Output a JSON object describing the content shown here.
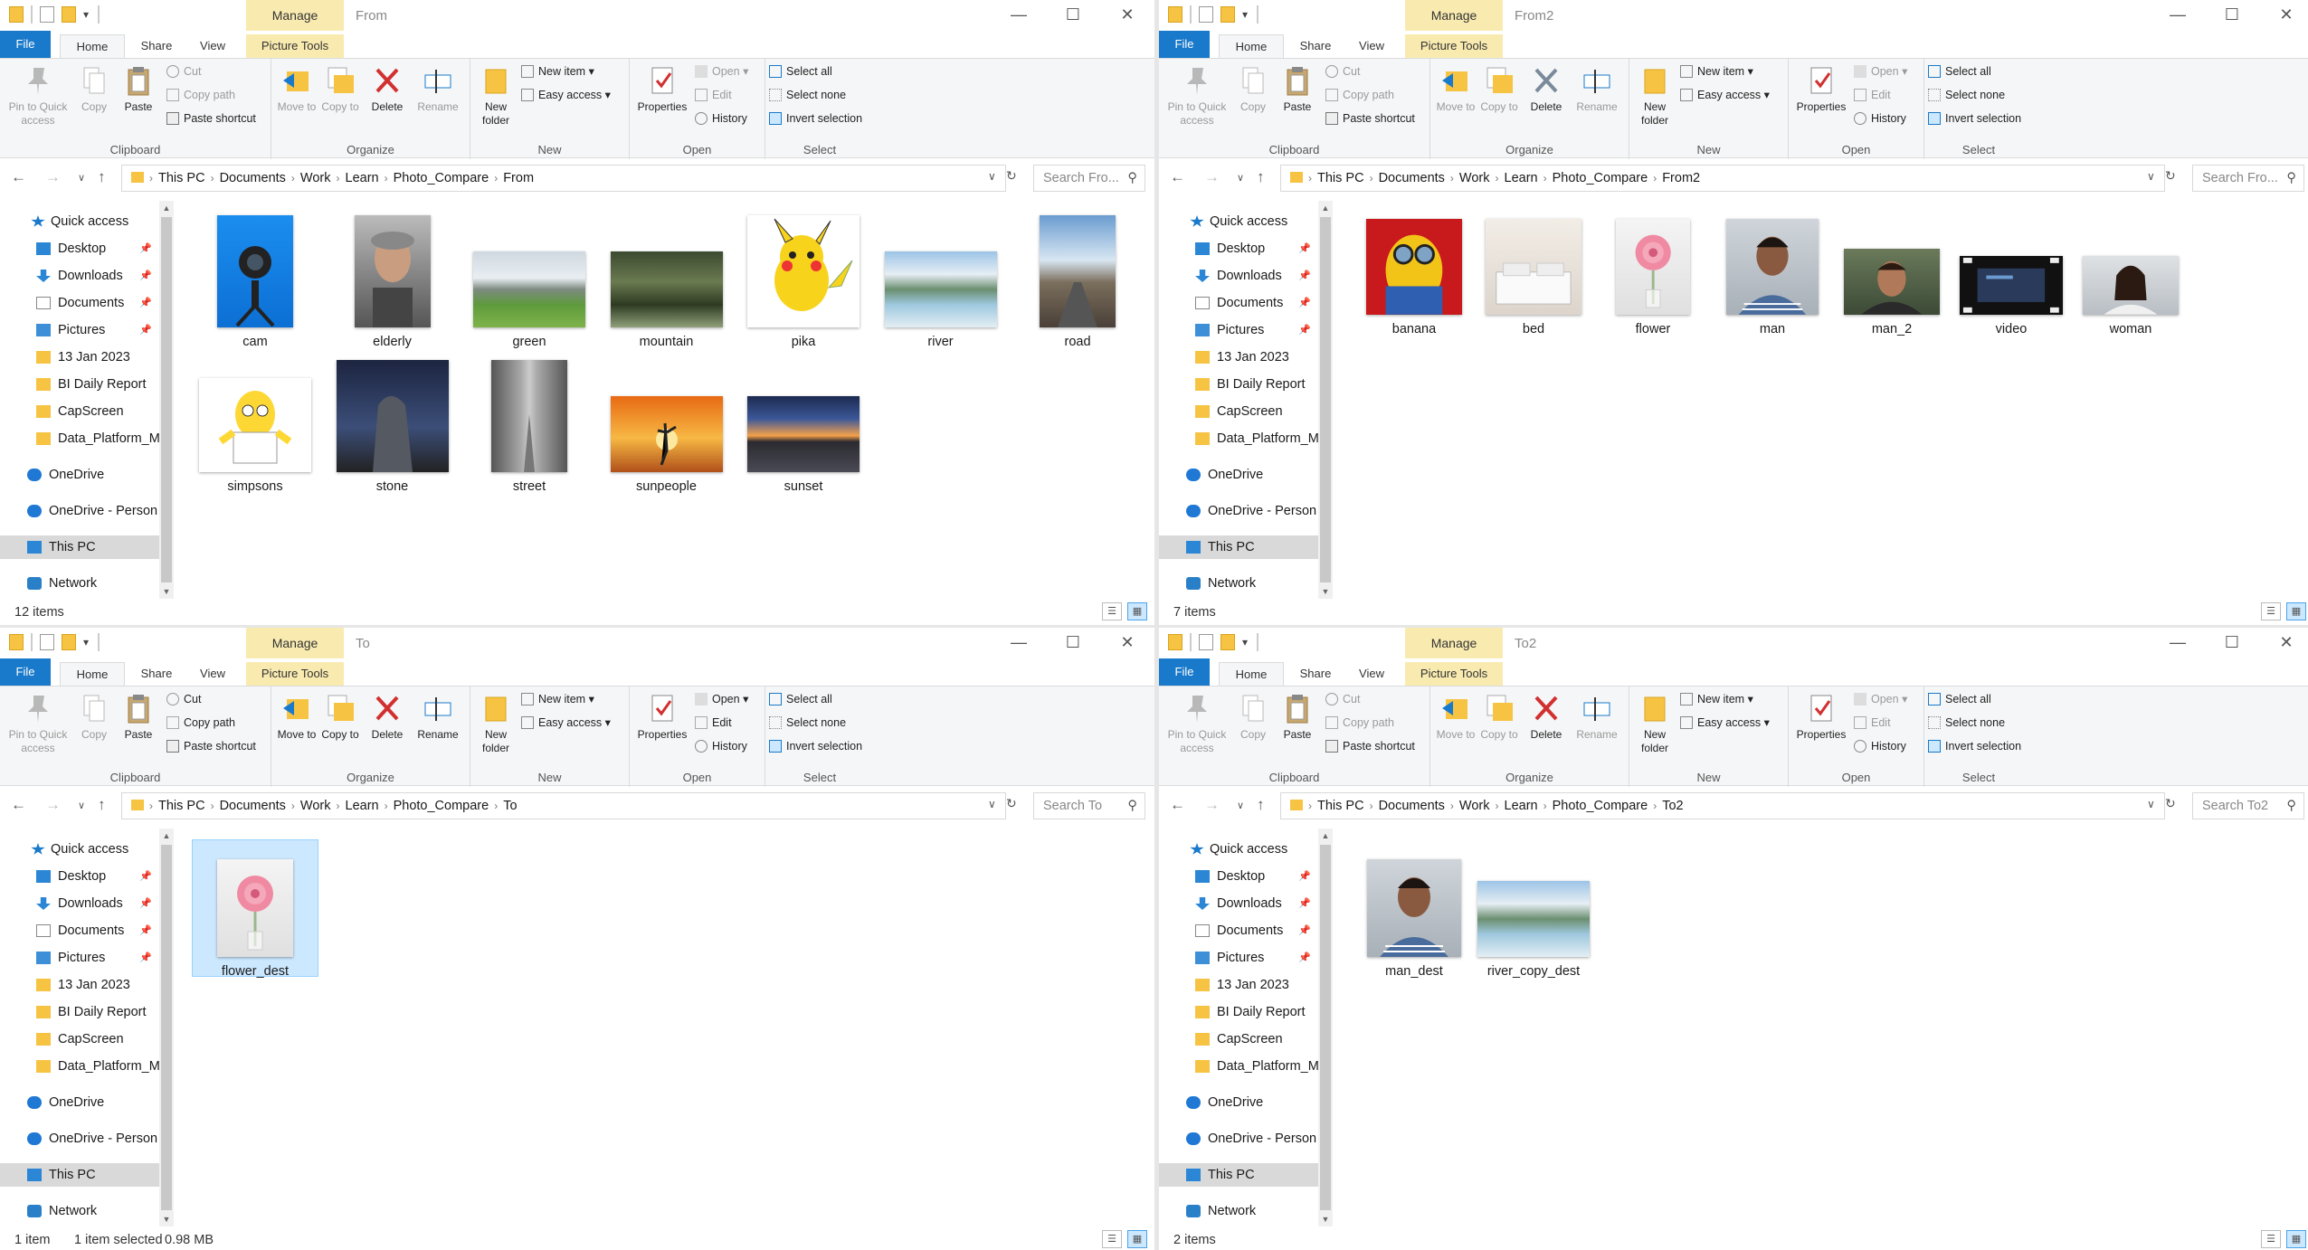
{
  "ribbon": {
    "tabs": {
      "file": "File",
      "home": "Home",
      "share": "Share",
      "view": "View",
      "picture_tools": "Picture Tools",
      "manage": "Manage"
    },
    "clipboard": {
      "pin": "Pin to Quick access",
      "copy": "Copy",
      "paste": "Paste",
      "cut": "Cut",
      "copy_path": "Copy path",
      "paste_shortcut": "Paste shortcut",
      "label": "Clipboard"
    },
    "organize": {
      "move_to": "Move to",
      "copy_to": "Copy to",
      "delete": "Delete",
      "rename": "Rename",
      "label": "Organize"
    },
    "new": {
      "new_folder": "New folder",
      "new_item": "New item",
      "easy_access": "Easy access",
      "label": "New"
    },
    "open": {
      "properties": "Properties",
      "open": "Open",
      "edit": "Edit",
      "history": "History",
      "label": "Open"
    },
    "select": {
      "select_all": "Select all",
      "select_none": "Select none",
      "invert": "Invert selection",
      "label": "Select"
    }
  },
  "nav_items": {
    "quick_access": "Quick access",
    "desktop": "Desktop",
    "downloads": "Downloads",
    "documents": "Documents",
    "pictures": "Pictures",
    "jan": "13 Jan 2023",
    "bi": "BI Daily Report",
    "capscreen": "CapScreen",
    "dataplat": "Data_Platform_M",
    "onedrive": "OneDrive",
    "onedrive_p": "OneDrive - Person",
    "thispc": "This PC",
    "network": "Network"
  },
  "windows": [
    {
      "title": "From",
      "path": [
        "This PC",
        "Documents",
        "Work",
        "Learn",
        "Photo_Compare",
        "From"
      ],
      "search": "Search Fro...",
      "status": "12 items",
      "status2": "",
      "status3": "",
      "files": [
        {
          "name": "cam",
          "kind": "cam"
        },
        {
          "name": "elderly",
          "kind": "elderly"
        },
        {
          "name": "green",
          "kind": "green"
        },
        {
          "name": "mountain",
          "kind": "mountain"
        },
        {
          "name": "pika",
          "kind": "pika"
        },
        {
          "name": "river",
          "kind": "river"
        },
        {
          "name": "road",
          "kind": "road"
        },
        {
          "name": "simpsons",
          "kind": "simpsons"
        },
        {
          "name": "stone",
          "kind": "stone"
        },
        {
          "name": "street",
          "kind": "street"
        },
        {
          "name": "sunpeople",
          "kind": "sunpeople"
        },
        {
          "name": "sunset",
          "kind": "sunset"
        }
      ]
    },
    {
      "title": "From2",
      "path": [
        "This PC",
        "Documents",
        "Work",
        "Learn",
        "Photo_Compare",
        "From2"
      ],
      "search": "Search Fro...",
      "status": "7 items",
      "status2": "",
      "status3": "",
      "files": [
        {
          "name": "banana",
          "kind": "banana"
        },
        {
          "name": "bed",
          "kind": "bed"
        },
        {
          "name": "flower",
          "kind": "flower"
        },
        {
          "name": "man",
          "kind": "man"
        },
        {
          "name": "man_2",
          "kind": "man2"
        },
        {
          "name": "video",
          "kind": "video"
        },
        {
          "name": "woman",
          "kind": "woman"
        }
      ]
    },
    {
      "title": "To",
      "path": [
        "This PC",
        "Documents",
        "Work",
        "Learn",
        "Photo_Compare",
        "To"
      ],
      "search": "Search To",
      "status": "1 item",
      "status2": "1 item selected",
      "status3": "0.98 MB",
      "files": [
        {
          "name": "flower_dest",
          "kind": "flower",
          "selected": true
        }
      ]
    },
    {
      "title": "To2",
      "path": [
        "This PC",
        "Documents",
        "Work",
        "Learn",
        "Photo_Compare",
        "To2"
      ],
      "search": "Search To2",
      "status": "2 items",
      "status2": "",
      "status3": "",
      "files": [
        {
          "name": "man_dest",
          "kind": "man"
        },
        {
          "name": "river_copy_dest",
          "kind": "river"
        }
      ]
    }
  ]
}
